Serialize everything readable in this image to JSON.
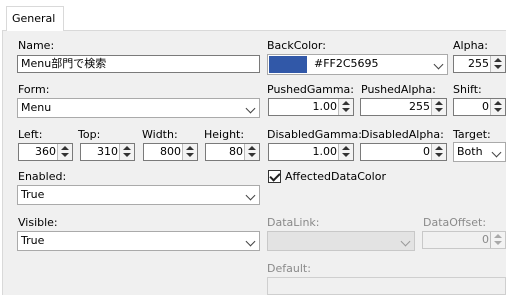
{
  "tabs": [
    {
      "label": "General"
    }
  ],
  "colors": {
    "backcolor_swatch": "#3158a8",
    "panel_bg": "#f0f0f0"
  },
  "icons": {
    "dropdown": "chevron-down-icon",
    "spin": "spin-up-down-icon",
    "check": "checkmark-icon"
  },
  "fields": {
    "name": {
      "label": "Name:",
      "value": "Menu部門で検索"
    },
    "form": {
      "label": "Form:",
      "value": "Menu"
    },
    "left": {
      "label": "Left:",
      "value": "360"
    },
    "top": {
      "label": "Top:",
      "value": "310"
    },
    "width": {
      "label": "Width:",
      "value": "800"
    },
    "height": {
      "label": "Height:",
      "value": "80"
    },
    "enabled": {
      "label": "Enabled:",
      "value": "True"
    },
    "visible": {
      "label": "Visible:",
      "value": "True"
    },
    "backcolor": {
      "label": "BackColor:",
      "value": "#FF2C5695"
    },
    "alpha": {
      "label": "Alpha:",
      "value": "255"
    },
    "pushed_gamma": {
      "label": "PushedGamma:",
      "value": "1.00"
    },
    "pushed_alpha": {
      "label": "PushedAlpha:",
      "value": "255"
    },
    "shift": {
      "label": "Shift:",
      "value": "0"
    },
    "disabled_gamma": {
      "label": "DisabledGamma:",
      "value": "1.00"
    },
    "disabled_alpha": {
      "label": "DisabledAlpha:",
      "value": "0"
    },
    "target": {
      "label": "Target:",
      "value": "Both"
    },
    "affected_data_color": {
      "label": "AffectedDataColor",
      "checked": true
    },
    "data_link": {
      "label": "DataLink:",
      "value": ""
    },
    "data_offset": {
      "label": "DataOffset:",
      "value": "0"
    },
    "default": {
      "label": "Default:",
      "value": ""
    }
  }
}
